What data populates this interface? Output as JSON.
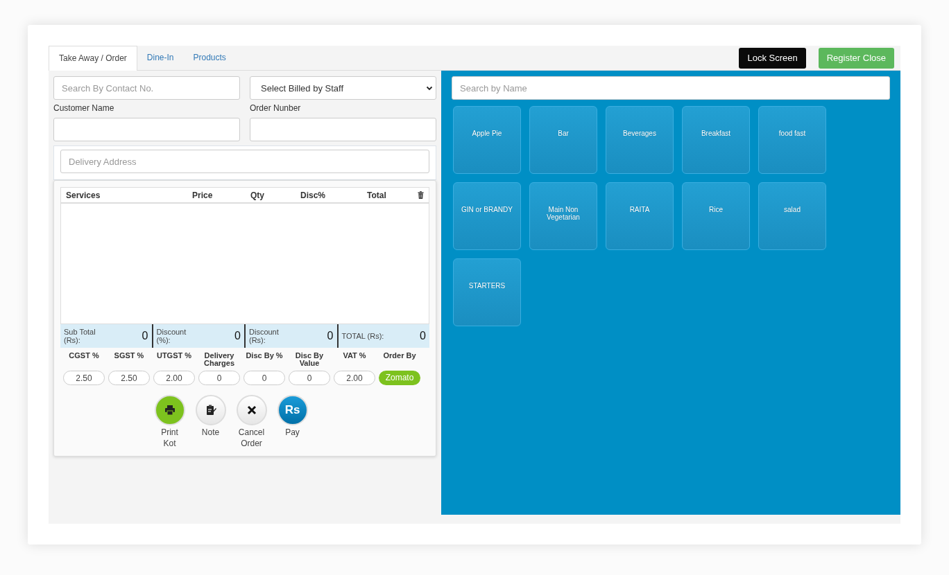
{
  "tabs": [
    {
      "label": "Take Away / Order",
      "selected": true
    },
    {
      "label": "Dine-In",
      "selected": false
    },
    {
      "label": "Products",
      "selected": false
    }
  ],
  "header_buttons": [
    {
      "label": "Lock Screen",
      "kind": "dark"
    },
    {
      "label": "Register Close",
      "kind": "success"
    }
  ],
  "order_form": {
    "contact_search": {
      "placeholder": "Search By Contact No."
    },
    "staff_select": {
      "value": "Select Billed by Staff"
    },
    "customer_name": {
      "label": "Customer Name"
    },
    "order_number": {
      "label": "Order Nunber"
    },
    "delivery_address": {
      "placeholder": "Delivery Address"
    }
  },
  "cart": {
    "columns": [
      "Services",
      "Price",
      "Qty",
      "Disc%",
      "Total"
    ],
    "totals": [
      {
        "label": "Sub Total (Rs):",
        "value": "0"
      },
      {
        "label": "Discount (%):",
        "value": "0"
      },
      {
        "label": "Discount (Rs):",
        "value": "0"
      },
      {
        "label": "TOTAL (Rs):",
        "value": "0"
      }
    ],
    "charges": [
      {
        "label": "CGST %",
        "value": "2.50",
        "kind": "input"
      },
      {
        "label": "SGST %",
        "value": "2.50",
        "kind": "input"
      },
      {
        "label": "UTGST %",
        "value": "2.00",
        "kind": "input"
      },
      {
        "label": "Delivery Charges",
        "value": "0",
        "kind": "input"
      },
      {
        "label": "Disc By %",
        "value": "0",
        "kind": "input"
      },
      {
        "label": "Disc By Value",
        "value": "0",
        "kind": "input"
      },
      {
        "label": "VAT %",
        "value": "2.00",
        "kind": "input"
      },
      {
        "label": "Order By",
        "value": "Zomato",
        "kind": "badge"
      }
    ],
    "actions": [
      {
        "label": "Print Kot",
        "kind": "print"
      },
      {
        "label": "Note",
        "kind": "note"
      },
      {
        "label": "Cancel Order",
        "kind": "cancel"
      },
      {
        "label": "Pay",
        "kind": "pay",
        "glyph": "Rs"
      }
    ]
  },
  "product_search": {
    "placeholder": "Search by Name"
  },
  "categories": [
    "Apple Pie",
    "Bar",
    "Beverages",
    "Breakfast",
    "food fast",
    "GIN or BRANDY",
    "Main Non Vegetarian",
    "RAITA",
    "Rice",
    "salad",
    "STARTERS"
  ]
}
